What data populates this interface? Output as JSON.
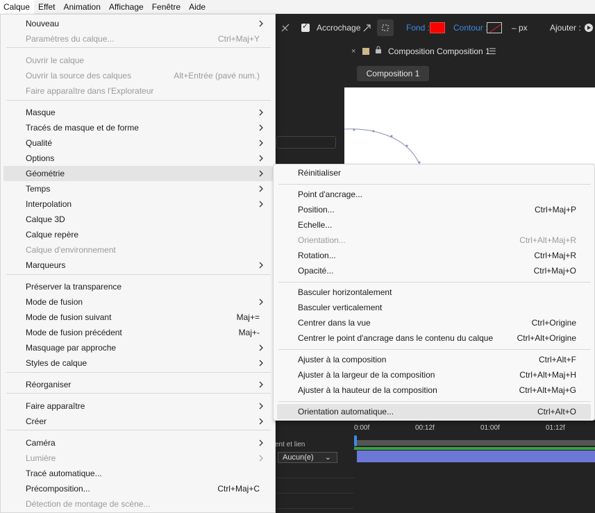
{
  "menubar": {
    "items": [
      "Calque",
      "Effet",
      "Animation",
      "Affichage",
      "Fenêtre",
      "Aide"
    ]
  },
  "toolbar": {
    "snapping": "Accrochage",
    "fill": "Fond :",
    "stroke": "Contour :",
    "stroke_width": "– px",
    "add": "Ajouter :"
  },
  "comp_panel": {
    "title": "Composition Composition 1",
    "tab": "Composition 1"
  },
  "timeline": {
    "ticks": [
      "0:00f",
      "00:12f",
      "01:00f",
      "01:12f"
    ],
    "parent_header": "ent et lien",
    "parent_value": "Aucun(e)"
  },
  "main_menu": {
    "items": [
      {
        "label": "Nouveau",
        "shortcut": "",
        "submenu": true,
        "disabled": false
      },
      {
        "label": "Paramètres du calque...",
        "shortcut": "Ctrl+Maj+Y",
        "submenu": false,
        "disabled": true
      },
      {
        "label": "Ouvrir le calque",
        "shortcut": "",
        "submenu": false,
        "disabled": true
      },
      {
        "label": "Ouvrir la source des calques",
        "shortcut": "Alt+Entrée (pavé num.)",
        "submenu": false,
        "disabled": true
      },
      {
        "label": "Faire apparaître dans l'Explorateur",
        "shortcut": "",
        "submenu": false,
        "disabled": true
      },
      {
        "label": "Masque",
        "shortcut": "",
        "submenu": true,
        "disabled": false
      },
      {
        "label": "Tracés de masque et de forme",
        "shortcut": "",
        "submenu": true,
        "disabled": false
      },
      {
        "label": "Qualité",
        "shortcut": "",
        "submenu": true,
        "disabled": false
      },
      {
        "label": "Options",
        "shortcut": "",
        "submenu": true,
        "disabled": false
      },
      {
        "label": "Géométrie",
        "shortcut": "",
        "submenu": true,
        "disabled": false
      },
      {
        "label": "Temps",
        "shortcut": "",
        "submenu": true,
        "disabled": false
      },
      {
        "label": "Interpolation",
        "shortcut": "",
        "submenu": true,
        "disabled": false
      },
      {
        "label": "Calque 3D",
        "shortcut": "",
        "submenu": false,
        "disabled": false
      },
      {
        "label": "Calque repère",
        "shortcut": "",
        "submenu": false,
        "disabled": false
      },
      {
        "label": "Calque d'environnement",
        "shortcut": "",
        "submenu": false,
        "disabled": true
      },
      {
        "label": "Marqueurs",
        "shortcut": "",
        "submenu": true,
        "disabled": false
      },
      {
        "label": "Préserver la transparence",
        "shortcut": "",
        "submenu": false,
        "disabled": false
      },
      {
        "label": "Mode de fusion",
        "shortcut": "",
        "submenu": true,
        "disabled": false
      },
      {
        "label": "Mode de fusion suivant",
        "shortcut": "Maj+=",
        "submenu": false,
        "disabled": false
      },
      {
        "label": "Mode de fusion précédent",
        "shortcut": "Maj+-",
        "submenu": false,
        "disabled": false
      },
      {
        "label": "Masquage par approche",
        "shortcut": "",
        "submenu": true,
        "disabled": false
      },
      {
        "label": "Styles de calque",
        "shortcut": "",
        "submenu": true,
        "disabled": false
      },
      {
        "label": "Réorganiser",
        "shortcut": "",
        "submenu": true,
        "disabled": false
      },
      {
        "label": "Faire apparaître",
        "shortcut": "",
        "submenu": true,
        "disabled": false
      },
      {
        "label": "Créer",
        "shortcut": "",
        "submenu": true,
        "disabled": false
      },
      {
        "label": "Caméra",
        "shortcut": "",
        "submenu": true,
        "disabled": false
      },
      {
        "label": "Lumière",
        "shortcut": "",
        "submenu": true,
        "disabled": true
      },
      {
        "label": "Tracé automatique...",
        "shortcut": "",
        "submenu": false,
        "disabled": false
      },
      {
        "label": "Précomposition...",
        "shortcut": "Ctrl+Maj+C",
        "submenu": false,
        "disabled": false
      },
      {
        "label": "Détection de montage de scène...",
        "shortcut": "",
        "submenu": false,
        "disabled": true
      }
    ]
  },
  "geometry_submenu": {
    "items": [
      {
        "label": "Réinitialiser",
        "shortcut": "",
        "disabled": false
      },
      {
        "label": "Point d'ancrage...",
        "shortcut": "",
        "disabled": false
      },
      {
        "label": "Position...",
        "shortcut": "Ctrl+Maj+P",
        "disabled": false
      },
      {
        "label": "Echelle...",
        "shortcut": "",
        "disabled": false
      },
      {
        "label": "Orientation...",
        "shortcut": "Ctrl+Alt+Maj+R",
        "disabled": true
      },
      {
        "label": "Rotation...",
        "shortcut": "Ctrl+Maj+R",
        "disabled": false
      },
      {
        "label": "Opacité...",
        "shortcut": "Ctrl+Maj+O",
        "disabled": false
      },
      {
        "label": "Basculer horizontalement",
        "shortcut": "",
        "disabled": false
      },
      {
        "label": "Basculer verticalement",
        "shortcut": "",
        "disabled": false
      },
      {
        "label": "Centrer dans la vue",
        "shortcut": "Ctrl+Origine",
        "disabled": false
      },
      {
        "label": "Centrer le point d'ancrage dans le contenu du calque",
        "shortcut": "Ctrl+Alt+Origine",
        "disabled": false
      },
      {
        "label": "Ajuster à la composition",
        "shortcut": "Ctrl+Alt+F",
        "disabled": false
      },
      {
        "label": "Ajuster à la largeur de la composition",
        "shortcut": "Ctrl+Alt+Maj+H",
        "disabled": false
      },
      {
        "label": "Ajuster à la hauteur de la composition",
        "shortcut": "Ctrl+Alt+Maj+G",
        "disabled": false
      },
      {
        "label": "Orientation automatique...",
        "shortcut": "Ctrl+Alt+O",
        "disabled": false
      }
    ]
  },
  "colors": {
    "fill": "#ff0000",
    "accent": "#3d8ae6",
    "layer_bar": "#6c77d6"
  }
}
